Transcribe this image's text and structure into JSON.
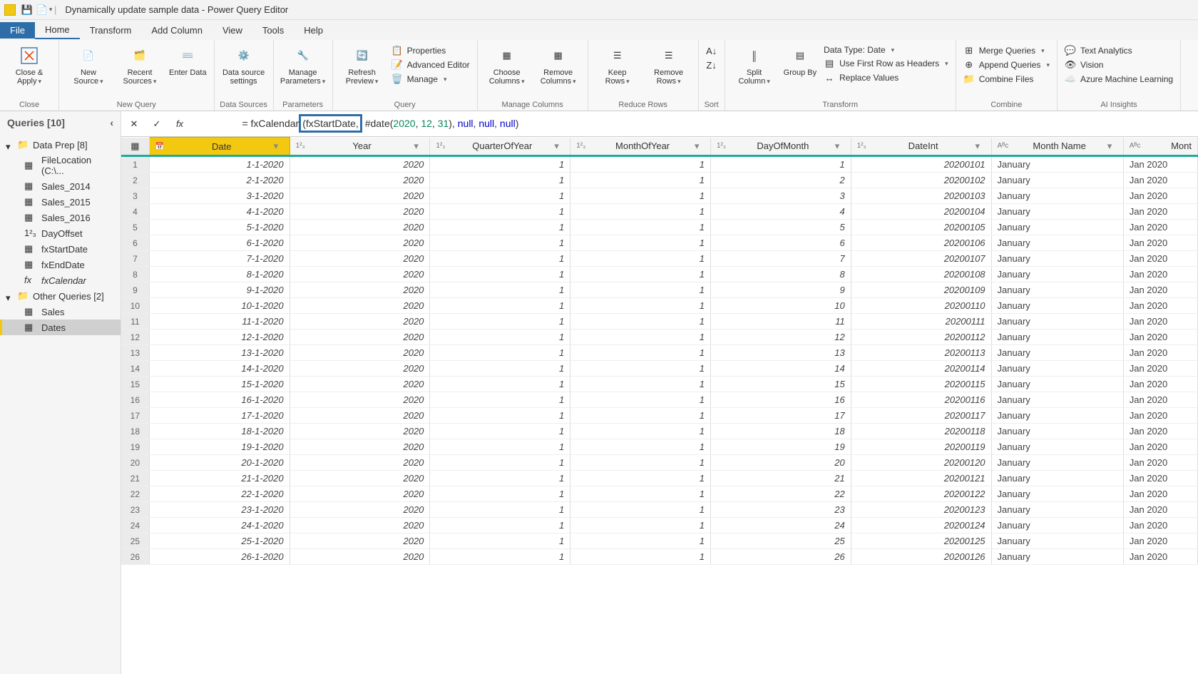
{
  "window": {
    "title": "Dynamically update sample data - Power Query Editor"
  },
  "menu": {
    "file": "File",
    "home": "Home",
    "transform": "Transform",
    "add": "Add Column",
    "view": "View",
    "tools": "Tools",
    "help": "Help"
  },
  "ribbon": {
    "close": {
      "label": "Close &\nApply",
      "group": "Close"
    },
    "new_query_group": "New Query",
    "new_src": "New\nSource",
    "recent": "Recent\nSources",
    "enter": "Enter\nData",
    "data_sources_group": "Data Sources",
    "ds": "Data source\nsettings",
    "params_group": "Parameters",
    "params": "Manage\nParameters",
    "query_group": "Query",
    "refresh": "Refresh\nPreview",
    "props": "Properties",
    "adv": "Advanced Editor",
    "manage": "Manage",
    "mc_group": "Manage Columns",
    "choose": "Choose\nColumns",
    "removec": "Remove\nColumns",
    "rr_group": "Reduce Rows",
    "keep": "Keep\nRows",
    "remover": "Remove\nRows",
    "sort_group": "Sort",
    "split": "Split\nColumn",
    "group": "Group\nBy",
    "transform_group": "Transform",
    "dtype": "Data Type: Date",
    "headers": "Use First Row as Headers",
    "replace": "Replace Values",
    "combine_group": "Combine",
    "merge": "Merge Queries",
    "append": "Append Queries",
    "cfiles": "Combine Files",
    "ai_group": "AI Insights",
    "text": "Text Analytics",
    "vision": "Vision",
    "azure": "Azure Machine Learning"
  },
  "sidebar": {
    "title": "Queries [10]",
    "folder1": "Data Prep [8]",
    "items1": [
      "FileLocation (C:\\...",
      "Sales_2014",
      "Sales_2015",
      "Sales_2016",
      "DayOffset",
      "fxStartDate",
      "fxEndDate",
      "fxCalendar"
    ],
    "folder2": "Other Queries [2]",
    "items2": [
      "Sales",
      "Dates"
    ]
  },
  "formula": {
    "pre": "= fxCalendar",
    "hl": "(fxStartDate,",
    "post1": " #date",
    "post2": "(",
    "n1": "2020",
    "c1": ", ",
    "n2": "12",
    "c2": ", ",
    "n3": "31",
    "post3": "), ",
    "k1": "null",
    "c3": ", ",
    "k2": "null",
    "c4": ", ",
    "k3": "null",
    "post4": ")"
  },
  "columns": [
    "Date",
    "Year",
    "QuarterOfYear",
    "MonthOfYear",
    "DayOfMonth",
    "DateInt",
    "Month Name",
    "Mont"
  ],
  "coltypes": [
    "📅",
    "1²₃",
    "1²₃",
    "1²₃",
    "1²₃",
    "1²₃",
    "Aᴮc",
    "Aᴮc"
  ],
  "rows": [
    {
      "n": 1,
      "d": "1-1-2020",
      "y": "2020",
      "q": "1",
      "m": "1",
      "dm": "1",
      "di": "20200101",
      "mn": "January",
      "mon": "Jan 2020"
    },
    {
      "n": 2,
      "d": "2-1-2020",
      "y": "2020",
      "q": "1",
      "m": "1",
      "dm": "2",
      "di": "20200102",
      "mn": "January",
      "mon": "Jan 2020"
    },
    {
      "n": 3,
      "d": "3-1-2020",
      "y": "2020",
      "q": "1",
      "m": "1",
      "dm": "3",
      "di": "20200103",
      "mn": "January",
      "mon": "Jan 2020"
    },
    {
      "n": 4,
      "d": "4-1-2020",
      "y": "2020",
      "q": "1",
      "m": "1",
      "dm": "4",
      "di": "20200104",
      "mn": "January",
      "mon": "Jan 2020"
    },
    {
      "n": 5,
      "d": "5-1-2020",
      "y": "2020",
      "q": "1",
      "m": "1",
      "dm": "5",
      "di": "20200105",
      "mn": "January",
      "mon": "Jan 2020"
    },
    {
      "n": 6,
      "d": "6-1-2020",
      "y": "2020",
      "q": "1",
      "m": "1",
      "dm": "6",
      "di": "20200106",
      "mn": "January",
      "mon": "Jan 2020"
    },
    {
      "n": 7,
      "d": "7-1-2020",
      "y": "2020",
      "q": "1",
      "m": "1",
      "dm": "7",
      "di": "20200107",
      "mn": "January",
      "mon": "Jan 2020"
    },
    {
      "n": 8,
      "d": "8-1-2020",
      "y": "2020",
      "q": "1",
      "m": "1",
      "dm": "8",
      "di": "20200108",
      "mn": "January",
      "mon": "Jan 2020"
    },
    {
      "n": 9,
      "d": "9-1-2020",
      "y": "2020",
      "q": "1",
      "m": "1",
      "dm": "9",
      "di": "20200109",
      "mn": "January",
      "mon": "Jan 2020"
    },
    {
      "n": 10,
      "d": "10-1-2020",
      "y": "2020",
      "q": "1",
      "m": "1",
      "dm": "10",
      "di": "20200110",
      "mn": "January",
      "mon": "Jan 2020"
    },
    {
      "n": 11,
      "d": "11-1-2020",
      "y": "2020",
      "q": "1",
      "m": "1",
      "dm": "11",
      "di": "20200111",
      "mn": "January",
      "mon": "Jan 2020"
    },
    {
      "n": 12,
      "d": "12-1-2020",
      "y": "2020",
      "q": "1",
      "m": "1",
      "dm": "12",
      "di": "20200112",
      "mn": "January",
      "mon": "Jan 2020"
    },
    {
      "n": 13,
      "d": "13-1-2020",
      "y": "2020",
      "q": "1",
      "m": "1",
      "dm": "13",
      "di": "20200113",
      "mn": "January",
      "mon": "Jan 2020"
    },
    {
      "n": 14,
      "d": "14-1-2020",
      "y": "2020",
      "q": "1",
      "m": "1",
      "dm": "14",
      "di": "20200114",
      "mn": "January",
      "mon": "Jan 2020"
    },
    {
      "n": 15,
      "d": "15-1-2020",
      "y": "2020",
      "q": "1",
      "m": "1",
      "dm": "15",
      "di": "20200115",
      "mn": "January",
      "mon": "Jan 2020"
    },
    {
      "n": 16,
      "d": "16-1-2020",
      "y": "2020",
      "q": "1",
      "m": "1",
      "dm": "16",
      "di": "20200116",
      "mn": "January",
      "mon": "Jan 2020"
    },
    {
      "n": 17,
      "d": "17-1-2020",
      "y": "2020",
      "q": "1",
      "m": "1",
      "dm": "17",
      "di": "20200117",
      "mn": "January",
      "mon": "Jan 2020"
    },
    {
      "n": 18,
      "d": "18-1-2020",
      "y": "2020",
      "q": "1",
      "m": "1",
      "dm": "18",
      "di": "20200118",
      "mn": "January",
      "mon": "Jan 2020"
    },
    {
      "n": 19,
      "d": "19-1-2020",
      "y": "2020",
      "q": "1",
      "m": "1",
      "dm": "19",
      "di": "20200119",
      "mn": "January",
      "mon": "Jan 2020"
    },
    {
      "n": 20,
      "d": "20-1-2020",
      "y": "2020",
      "q": "1",
      "m": "1",
      "dm": "20",
      "di": "20200120",
      "mn": "January",
      "mon": "Jan 2020"
    },
    {
      "n": 21,
      "d": "21-1-2020",
      "y": "2020",
      "q": "1",
      "m": "1",
      "dm": "21",
      "di": "20200121",
      "mn": "January",
      "mon": "Jan 2020"
    },
    {
      "n": 22,
      "d": "22-1-2020",
      "y": "2020",
      "q": "1",
      "m": "1",
      "dm": "22",
      "di": "20200122",
      "mn": "January",
      "mon": "Jan 2020"
    },
    {
      "n": 23,
      "d": "23-1-2020",
      "y": "2020",
      "q": "1",
      "m": "1",
      "dm": "23",
      "di": "20200123",
      "mn": "January",
      "mon": "Jan 2020"
    },
    {
      "n": 24,
      "d": "24-1-2020",
      "y": "2020",
      "q": "1",
      "m": "1",
      "dm": "24",
      "di": "20200124",
      "mn": "January",
      "mon": "Jan 2020"
    },
    {
      "n": 25,
      "d": "25-1-2020",
      "y": "2020",
      "q": "1",
      "m": "1",
      "dm": "25",
      "di": "20200125",
      "mn": "January",
      "mon": "Jan 2020"
    },
    {
      "n": 26,
      "d": "26-1-2020",
      "y": "2020",
      "q": "1",
      "m": "1",
      "dm": "26",
      "di": "20200126",
      "mn": "January",
      "mon": "Jan 2020"
    }
  ]
}
